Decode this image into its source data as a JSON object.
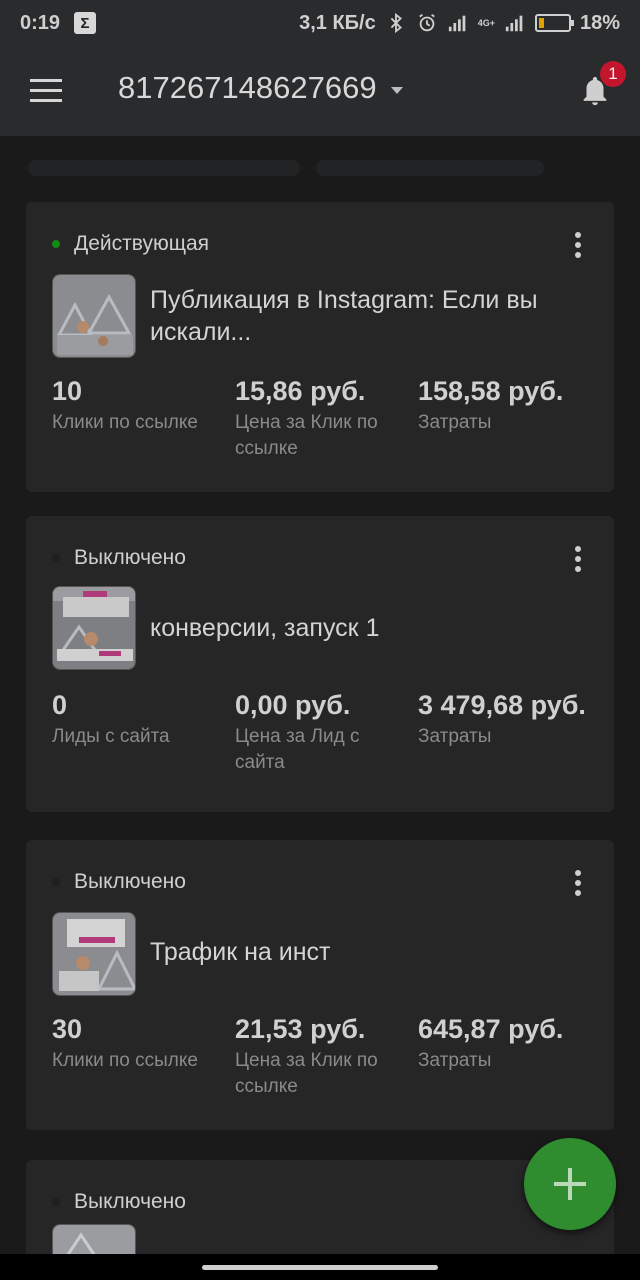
{
  "status_bar": {
    "time": "0:19",
    "sigma": "Σ",
    "speed": "3,1 КБ/с",
    "network": "4G+",
    "battery_percent_text": "18%",
    "battery_level": 0.18,
    "battery_color": "#e0a000"
  },
  "app_bar": {
    "account_id": "817267148627669",
    "notification_count": "1"
  },
  "campaigns": [
    {
      "status": "Действующая",
      "title": "Публикация в Instagram: Если вы искали...",
      "metrics": [
        {
          "value": "10",
          "label": "Клики по ссылке"
        },
        {
          "value": "15,86 руб.",
          "label": "Цена за Клик по ссылке"
        },
        {
          "value": "158,58 руб.",
          "label": "Затраты"
        }
      ]
    },
    {
      "status": "Выключено",
      "title": "конверсии, запуск 1",
      "metrics": [
        {
          "value": "0",
          "label": "Лиды с сайта"
        },
        {
          "value": "0,00 руб.",
          "label": "Цена за Лид с сайта"
        },
        {
          "value": "3 479,68 руб.",
          "label": "Затраты"
        }
      ]
    },
    {
      "status": "Выключено",
      "title": "Трафик на инст",
      "metrics": [
        {
          "value": "30",
          "label": "Клики по ссылке"
        },
        {
          "value": "21,53 руб.",
          "label": "Цена за Клик по ссылке"
        },
        {
          "value": "645,87 руб.",
          "label": "Затраты"
        }
      ]
    },
    {
      "status": "Выключено"
    }
  ],
  "colors": {
    "active_dot": "#128b12",
    "fab": "#2f8d2f",
    "badge": "#c3152c"
  }
}
